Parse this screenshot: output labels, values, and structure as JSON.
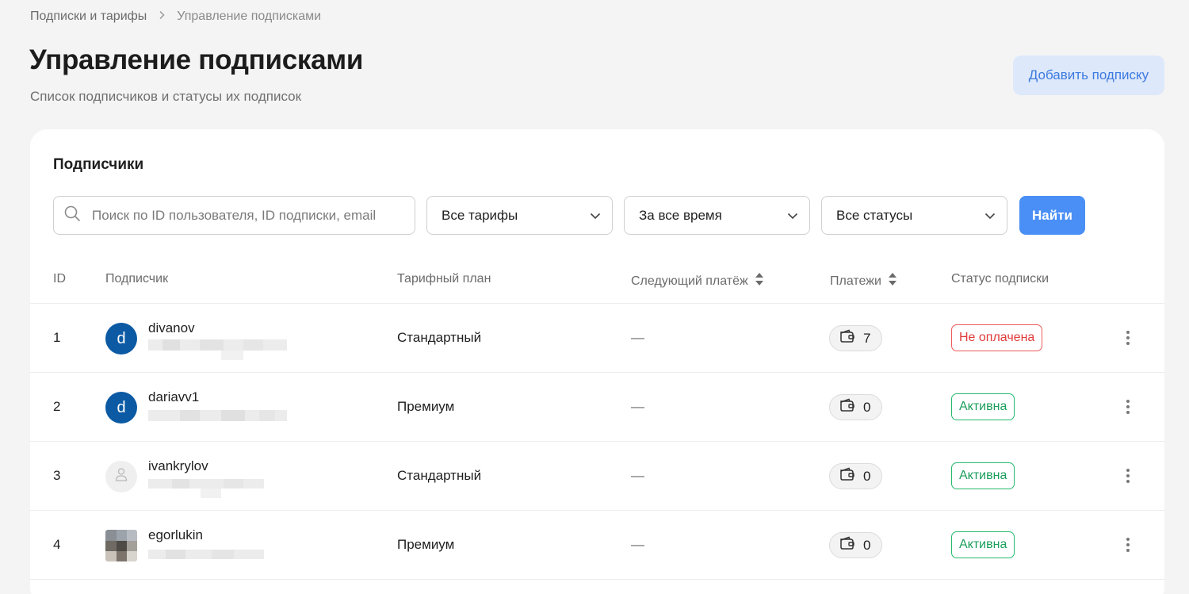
{
  "breadcrumb": {
    "parent": "Подписки и тарифы",
    "current": "Управление подписками"
  },
  "header": {
    "title": "Управление подписками",
    "subtitle": "Список подписчиков и статусы их подписок",
    "add_button": "Добавить подписку"
  },
  "card": {
    "title": "Подписчики"
  },
  "filters": {
    "search_placeholder": "Поиск по ID пользователя, ID подписки, email",
    "tariff": "Все тарифы",
    "period": "За все время",
    "status": "Все статусы",
    "find_button": "Найти"
  },
  "columns": {
    "id": "ID",
    "subscriber": "Подписчик",
    "plan": "Тарифный план",
    "next_payment": "Следующий платёж",
    "payments": "Платежи",
    "status": "Статус подписки"
  },
  "rows": [
    {
      "id": "1",
      "avatar": "d",
      "username": "divanov",
      "plan": "Стандартный",
      "next_payment": "—",
      "payments": "7",
      "status": "Не оплачена"
    },
    {
      "id": "2",
      "avatar": "d",
      "username": "dariavv1",
      "plan": "Премиум",
      "next_payment": "—",
      "payments": "0",
      "status": "Активна"
    },
    {
      "id": "3",
      "avatar": "",
      "username": "ivankrylov",
      "plan": "Стандартный",
      "next_payment": "—",
      "payments": "0",
      "status": "Активна"
    },
    {
      "id": "4",
      "avatar": "",
      "username": "egorlukin",
      "plan": "Премиум",
      "next_payment": "—",
      "payments": "0",
      "status": "Активна"
    }
  ],
  "colors": {
    "accent": "#4a8ff5",
    "avatar_blue": "#0b5aa3",
    "status_unpaid": "#e03a3a",
    "status_active": "#1a9e5b"
  },
  "icons": [
    "search-icon",
    "chevron-down-icon",
    "sort-icon",
    "wallet-icon",
    "user-placeholder-icon",
    "more-vertical-icon",
    "chevron-right-icon"
  ]
}
